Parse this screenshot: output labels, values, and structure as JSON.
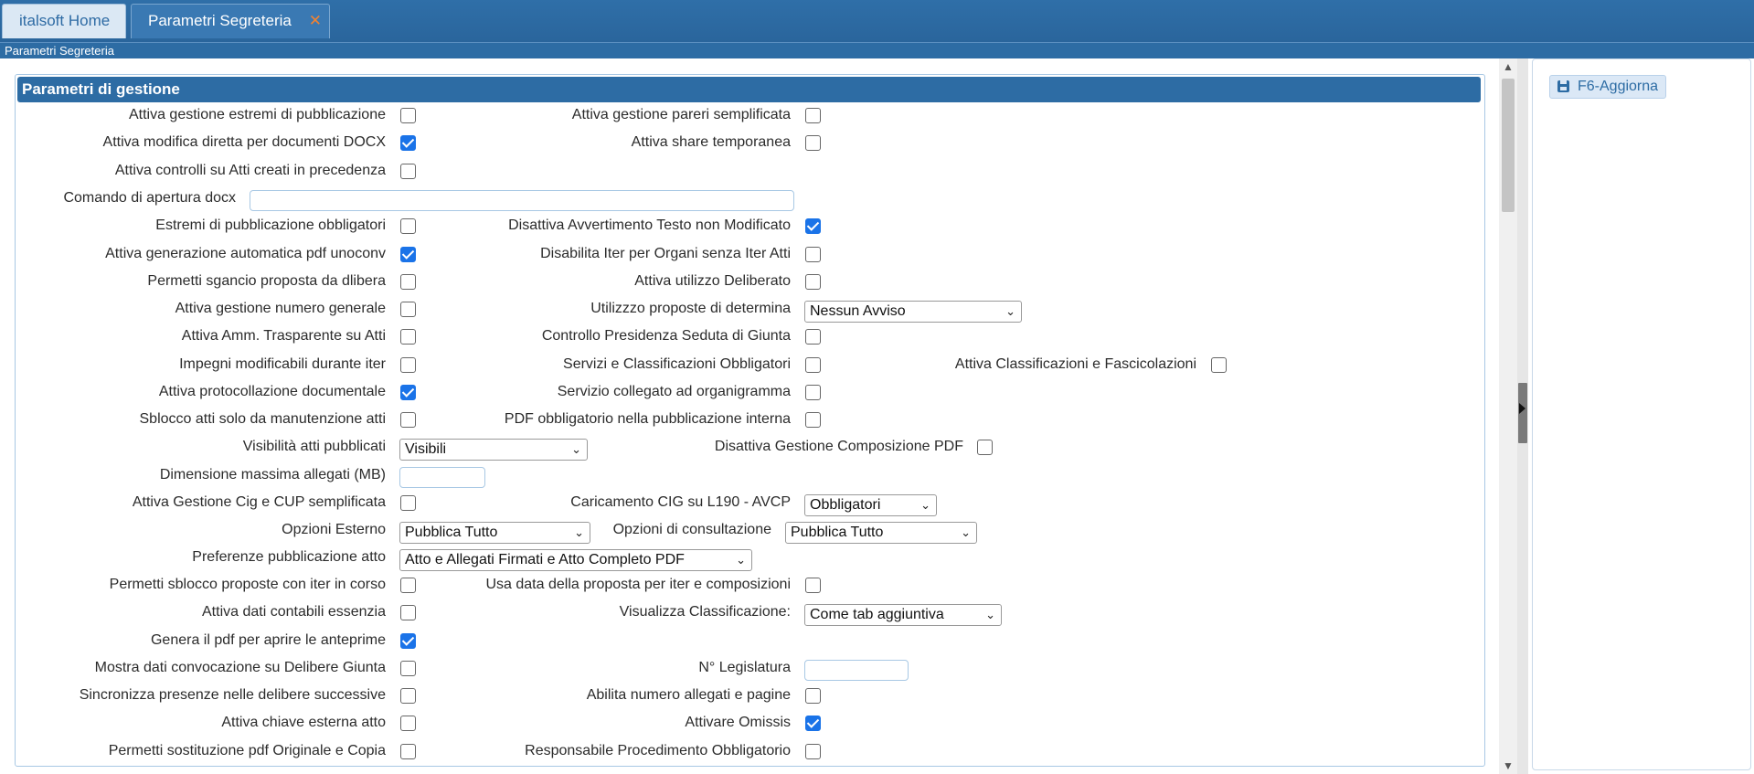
{
  "tabs": {
    "home": "italsoft Home",
    "params": "Parametri Segreteria",
    "close_glyph": "✕"
  },
  "breadcrumb": "Parametri Segreteria",
  "panel": {
    "title": "Parametri di gestione"
  },
  "actions": {
    "update": "F6-Aggiorna"
  },
  "labels": {
    "estremi_pubblicazione": "Attiva gestione estremi di pubblicazione",
    "pareri_semplificata": "Attiva gestione pareri semplificata",
    "modifica_docx": "Attiva modifica diretta per documenti DOCX",
    "share_temporanea": "Attiva share temporanea",
    "controlli_atti": "Attiva controlli su Atti creati in precedenza",
    "comando_docx": "Comando di apertura docx",
    "estremi_obbligatori": "Estremi di pubblicazione obbligatori",
    "disattiva_avvertimento": "Disattiva Avvertimento Testo non Modificato",
    "pdf_unoconv": "Attiva generazione automatica pdf unoconv",
    "disabilita_iter": "Disabilita Iter per Organi senza Iter Atti",
    "sgancio_proposta": "Permetti sgancio proposta da dlibera",
    "utilizzo_deliberato": "Attiva utilizzo Deliberato",
    "numero_generale": "Attiva gestione numero generale",
    "proposte_determina": "Utilizzzo proposte di determina",
    "amm_trasparente": "Attiva Amm. Trasparente su Atti",
    "presidenza_giunta": "Controllo Presidenza Seduta di Giunta",
    "impegni_iter": "Impegni modificabili durante iter",
    "servizi_obbligatori": "Servizi e Classificazioni Obbligatori",
    "classificazioni_fascicolazioni": "Attiva Classificazioni e Fascicolazioni",
    "protocollazione": "Attiva protocollazione documentale",
    "servizio_organigramma": "Servizio collegato ad organigramma",
    "sblocco_manutenzione": "Sblocco atti solo da manutenzione atti",
    "pdf_pubblicazione_interna": "PDF obbligatorio nella pubblicazione interna",
    "visibilita_atti": "Visibilità  atti pubblicati",
    "composizione_pdf": "Disattiva Gestione Composizione PDF",
    "dimensione_allegati": "Dimensione massima allegati (MB)",
    "cig_cup": "Attiva Gestione Cig e CUP semplificata",
    "caricamento_cig": "Caricamento CIG su L190 - AVCP",
    "opzioni_esterno": "Opzioni Esterno",
    "opzioni_consultazione": "Opzioni di consultazione",
    "preferenze_pubblicazione": "Preferenze pubblicazione atto",
    "sblocco_iter": "Permetti sblocco proposte con iter in corso",
    "data_proposta": "Usa data della proposta per iter e composizioni",
    "dati_contabili": "Attiva dati contabili essenzia",
    "visualizza_classificazione": "Visualizza Classificazione:",
    "pdf_anteprime": "Genera il pdf per aprire le anteprime",
    "mostra_convocazione": "Mostra dati convocazione su Delibere Giunta",
    "legislatura": "N° Legislatura",
    "sincronizza_presenze": "Sincronizza presenze nelle delibere successive",
    "numero_allegati": "Abilita numero allegati e pagine",
    "chiave_esterna": "Attiva chiave esterna atto",
    "omissis": "Attivare Omissis",
    "sostituzione_pdf": "Permetti sostituzione pdf Originale e Copia",
    "responsabile_obbligatorio": "Responsabile Procedimento Obbligatorio"
  },
  "checks": {
    "estremi_pubblicazione": false,
    "pareri_semplificata": false,
    "modifica_docx": true,
    "share_temporanea": false,
    "controlli_atti": false,
    "estremi_obbligatori": false,
    "disattiva_avvertimento": true,
    "pdf_unoconv": true,
    "disabilita_iter": false,
    "sgancio_proposta": false,
    "utilizzo_deliberato": false,
    "numero_generale": false,
    "amm_trasparente": false,
    "presidenza_giunta": false,
    "impegni_iter": false,
    "servizi_obbligatori": false,
    "classificazioni_fascicolazioni": false,
    "protocollazione": true,
    "servizio_organigramma": false,
    "sblocco_manutenzione": false,
    "pdf_pubblicazione_interna": false,
    "composizione_pdf": false,
    "cig_cup": false,
    "sblocco_iter": false,
    "data_proposta": false,
    "dati_contabili": false,
    "pdf_anteprime": true,
    "mostra_convocazione": false,
    "sincronizza_presenze": false,
    "numero_allegati": false,
    "chiave_esterna": false,
    "omissis": true,
    "sostituzione_pdf": false,
    "responsabile_obbligatorio": false
  },
  "inputs": {
    "comando_docx": "",
    "dimensione_allegati": "",
    "legislatura": ""
  },
  "selects": {
    "proposte_determina": "Nessun Avviso",
    "visibilita_atti": "Visibili",
    "caricamento_cig": "Obbligatori",
    "opzioni_esterno": "Pubblica Tutto",
    "opzioni_consultazione": "Pubblica Tutto",
    "preferenze_pubblicazione": "Atto e Allegati Firmati e Atto Completo PDF",
    "visualizza_classificazione": "Come tab aggiuntiva"
  },
  "colors": {
    "brand": "#2d6ca4",
    "checkbox_on": "#1a73e8",
    "close_tab": "#f08232"
  }
}
